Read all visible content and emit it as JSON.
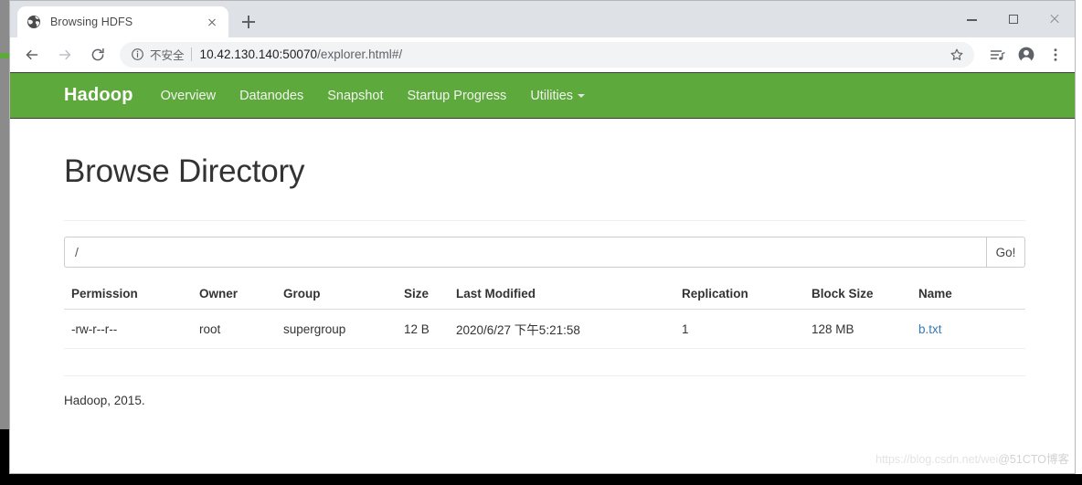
{
  "browser": {
    "tab": {
      "title": "Browsing HDFS",
      "favicon": "globe-icon",
      "close_label": "close-icon"
    },
    "new_tab_label": "+",
    "window_controls": {
      "minimize": "minimize-icon",
      "maximize": "maximize-icon",
      "close": "close-icon"
    },
    "toolbar": {
      "back": "back-arrow-icon",
      "forward": "forward-arrow-icon",
      "reload": "reload-icon",
      "security_icon": "info-circle-icon",
      "security_label": "不安全",
      "url_host": "10.42.130.140:50070",
      "url_path": "/explorer.html#/",
      "url_full": "10.42.130.140:50070/explorer.html#/",
      "bookmark": "star-icon",
      "media": "playlist-icon",
      "profile": "account-avatar-icon",
      "menu": "three-dot-menu-icon"
    }
  },
  "hadoop": {
    "brand": "Hadoop",
    "nav_items": [
      {
        "label": "Overview"
      },
      {
        "label": "Datanodes"
      },
      {
        "label": "Snapshot"
      },
      {
        "label": "Startup Progress"
      },
      {
        "label": "Utilities",
        "has_caret": true
      }
    ],
    "accent_color": "#5ea93b"
  },
  "page": {
    "title": "Browse Directory",
    "path_input": {
      "value": "/",
      "placeholder": ""
    },
    "go_button": "Go!",
    "table": {
      "headers": [
        "Permission",
        "Owner",
        "Group",
        "Size",
        "Last Modified",
        "Replication",
        "Block Size",
        "Name"
      ],
      "rows": [
        {
          "permission": "-rw-r--r--",
          "owner": "root",
          "group": "supergroup",
          "size": "12 B",
          "last_modified": "2020/6/27 下午5:21:58",
          "replication": "1",
          "block_size": "128 MB",
          "name": "b.txt"
        }
      ]
    },
    "footer": "Hadoop, 2015."
  },
  "watermark": {
    "part1": "https://blog.csdn.net/wei",
    "part2": "@51CTO博客"
  }
}
